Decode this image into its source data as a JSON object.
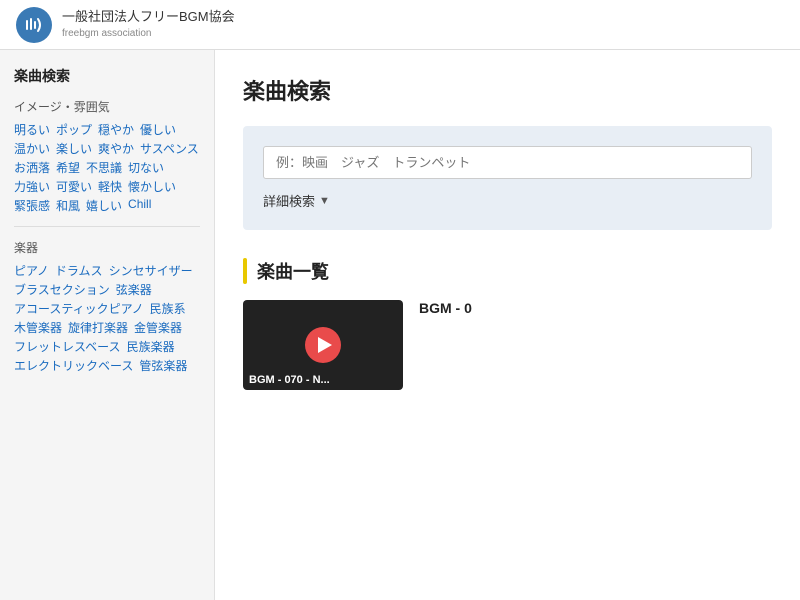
{
  "header": {
    "org_name_ja": "一般社団法人フリーBGM協会",
    "org_name_en": "freebgm association"
  },
  "sidebar": {
    "section_title": "楽曲検索",
    "category_image": "イメージ・雰囲気",
    "tags_image": [
      [
        "明るい",
        "ポップ",
        "穏やか"
      ],
      [
        "優しい",
        "温かい",
        "楽しい"
      ],
      [
        "爽やか",
        "サスペンス",
        "お洒落"
      ],
      [
        "希望",
        "不思議",
        "切ない"
      ],
      [
        "力強い",
        "可愛い",
        "軽快"
      ],
      [
        "懐かしい",
        "緊張感",
        "和風"
      ],
      [
        "嬉しい",
        "Chill"
      ]
    ],
    "category_instrument": "楽器",
    "tags_instrument": [
      [
        "ピアノ",
        "ドラムス"
      ],
      [
        "シンセサイザー"
      ],
      [
        "ブラスセクション",
        "弦楽器"
      ],
      [
        "アコースティックピアノ"
      ],
      [
        "民族系",
        "木管楽器"
      ],
      [
        "旋律打楽器",
        "金管楽器"
      ],
      [
        "フレットレスベース"
      ],
      [
        "民族楽器"
      ],
      [
        "エレクトリックベース"
      ],
      [
        "管弦楽器"
      ]
    ]
  },
  "main": {
    "page_title": "楽曲検索",
    "search": {
      "placeholder": "例：映画　ジャズ　トランペット",
      "detail_label": "詳細検索",
      "detail_arrow": "▼"
    },
    "music_list_title": "楽曲一覧",
    "music_items": [
      {
        "thumbnail_label": "BGM - 070 - N...",
        "title": "BGM - 0"
      }
    ]
  }
}
